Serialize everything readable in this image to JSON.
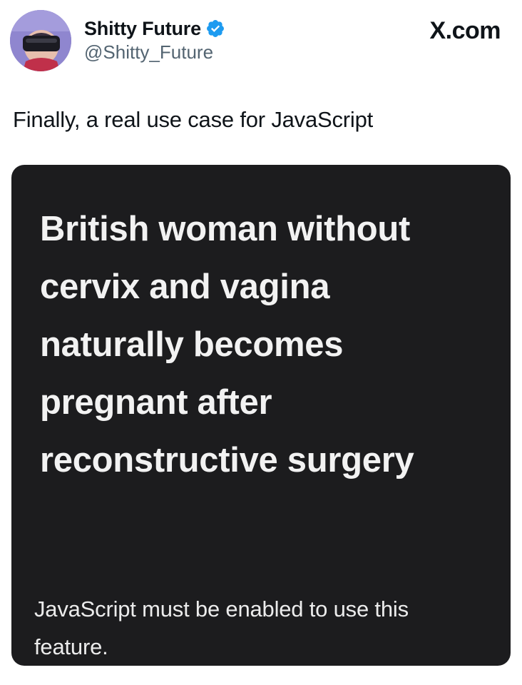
{
  "author": {
    "display_name": "Shitty Future",
    "handle": "@Shitty_Future",
    "verified": true,
    "avatar_icon": "vr-headset-avatar-icon"
  },
  "brand": "X.com",
  "tweet": {
    "text": "Finally, a real use case for JavaScript"
  },
  "media": {
    "headline_lines": [
      "British woman without",
      "cervix and vagina",
      "naturally becomes",
      "pregnant after",
      "reconstructive surgery"
    ],
    "notice_lines": [
      "JavaScript must be enabled to use this",
      "feature."
    ]
  },
  "colors": {
    "verified_badge": "#1d9bf0",
    "card_background": "#1c1c1e",
    "handle_gray": "#536471"
  }
}
